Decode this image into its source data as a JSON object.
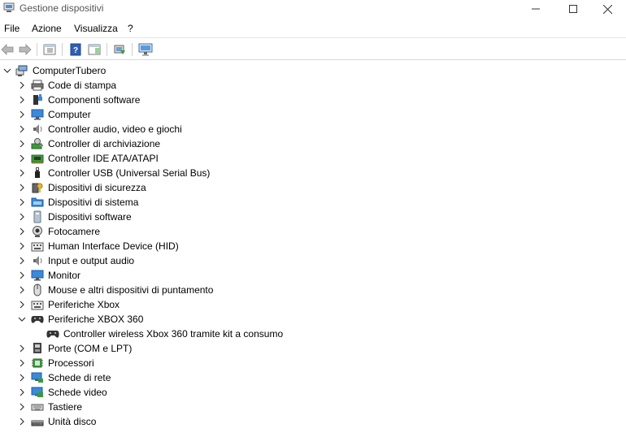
{
  "window": {
    "title": "Gestione dispositivi",
    "app_icon": "device-manager-icon",
    "controls": [
      "minimize-icon",
      "maximize-icon",
      "close-icon"
    ]
  },
  "menu": {
    "items": [
      {
        "label": "File"
      },
      {
        "label": "Azione"
      },
      {
        "label": "Visualizza"
      },
      {
        "label": "?"
      }
    ]
  },
  "toolbar": {
    "buttons": [
      "back-arrow-icon",
      "forward-arrow-icon",
      "properties-icon",
      "help-icon",
      "action-pane-icon",
      "update-driver-icon",
      "scan-hardware-icon"
    ]
  },
  "tree": {
    "root": {
      "label": "ComputerTubero",
      "icon": "computer-icon",
      "expanded": true
    },
    "categories": [
      {
        "label": "Code di stampa",
        "icon": "printer-icon"
      },
      {
        "label": "Componenti software",
        "icon": "software-component-icon"
      },
      {
        "label": "Computer",
        "icon": "monitor-icon"
      },
      {
        "label": "Controller audio, video e giochi",
        "icon": "speaker-icon"
      },
      {
        "label": "Controller di archiviazione",
        "icon": "storage-controller-icon"
      },
      {
        "label": "Controller IDE ATA/ATAPI",
        "icon": "ide-controller-icon"
      },
      {
        "label": "Controller USB (Universal Serial Bus)",
        "icon": "usb-icon"
      },
      {
        "label": "Dispositivi di sicurezza",
        "icon": "security-key-icon"
      },
      {
        "label": "Dispositivi di sistema",
        "icon": "system-folder-icon"
      },
      {
        "label": "Dispositivi software",
        "icon": "software-device-icon"
      },
      {
        "label": "Fotocamere",
        "icon": "camera-icon"
      },
      {
        "label": "Human Interface Device (HID)",
        "icon": "hid-icon"
      },
      {
        "label": "Input e output audio",
        "icon": "speaker-icon"
      },
      {
        "label": "Monitor",
        "icon": "monitor-icon"
      },
      {
        "label": "Mouse e altri dispositivi di puntamento",
        "icon": "mouse-icon"
      },
      {
        "label": "Periferiche Xbox",
        "icon": "hid-icon"
      },
      {
        "label": "Periferiche XBOX 360",
        "icon": "gamepad-icon",
        "expanded": true,
        "children": [
          {
            "label": "Controller wireless Xbox 360 tramite kit a consumo",
            "icon": "gamepad-icon"
          }
        ]
      },
      {
        "label": "Porte (COM e LPT)",
        "icon": "port-icon"
      },
      {
        "label": "Processori",
        "icon": "processor-icon"
      },
      {
        "label": "Schede di rete",
        "icon": "network-adapter-icon"
      },
      {
        "label": "Schede video",
        "icon": "display-adapter-icon"
      },
      {
        "label": "Tastiere",
        "icon": "keyboard-icon"
      },
      {
        "label": "Unità disco",
        "icon": "disk-drive-icon"
      }
    ]
  }
}
